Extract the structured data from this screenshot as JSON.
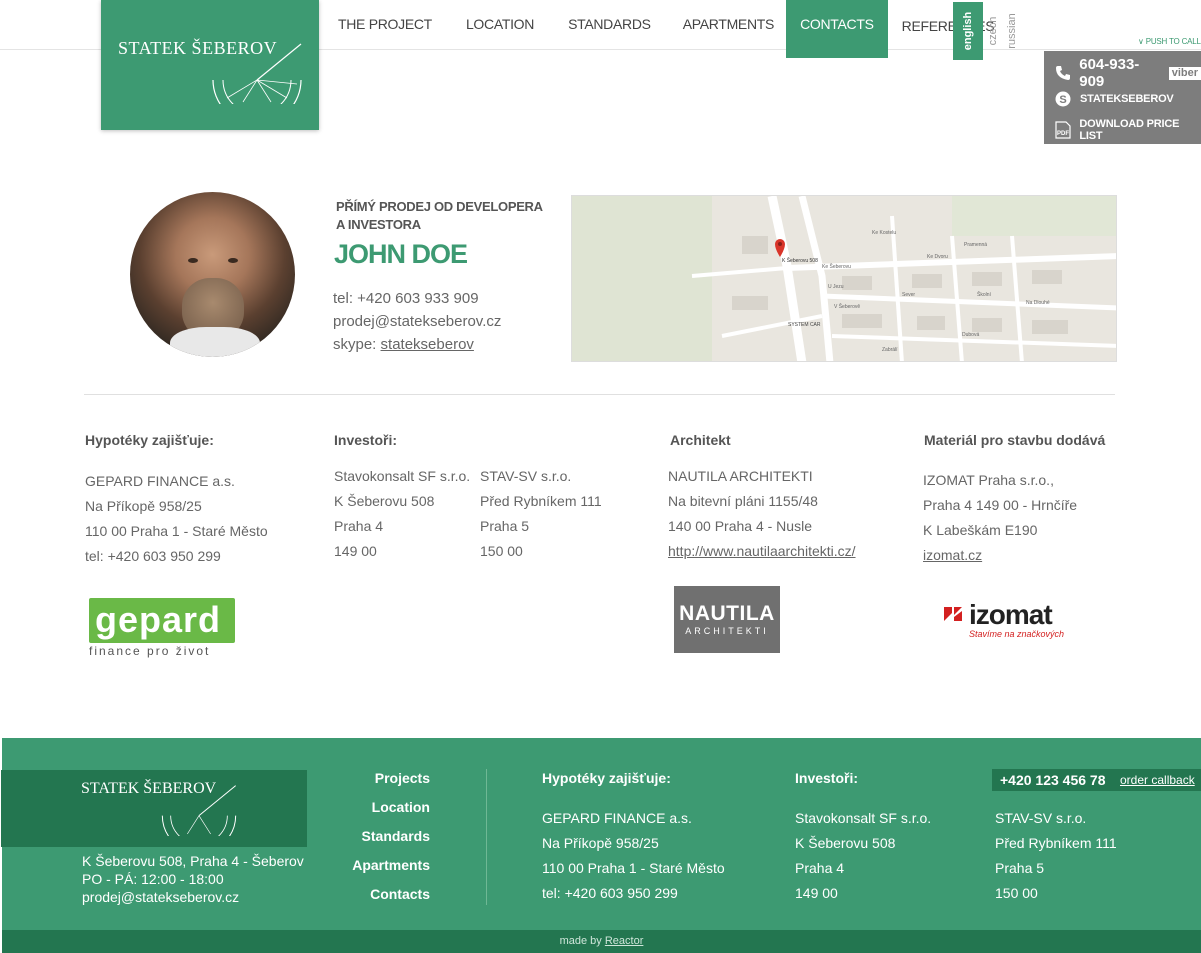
{
  "header": {
    "logo_text": "STATEK ŠEBEROV",
    "nav": [
      {
        "label": "THE PROJECT"
      },
      {
        "label": "LOCATION"
      },
      {
        "label": "STANDARDS"
      },
      {
        "label": "APARTMENTS"
      },
      {
        "label": "CONTACTS"
      },
      {
        "label": "REFERENCES"
      }
    ],
    "active_nav": "CONTACTS",
    "languages": [
      "english",
      "czech",
      "russian"
    ],
    "active_language": "english",
    "push_to_call": "PUSH TO CALL"
  },
  "callbox": {
    "phone": "604-933-909",
    "viber": "viber",
    "skype": "STATEKSEBEROV",
    "download": "DOWNLOAD PRICE LIST",
    "icons": [
      "phone-icon",
      "skype-icon",
      "pdf-icon"
    ]
  },
  "contact": {
    "subtitle_line1": "PŘÍMÝ PRODEJ OD DEVELOPERA",
    "subtitle_line2": "A INVESTORA",
    "name": "JOHN DOE",
    "tel": "tel: +420 603 933 909",
    "email": "prodej@statekseberov.cz",
    "skype_label": "skype: ",
    "skype_link": "statekseberov",
    "map_labels": [
      "K Šeberovu 508",
      "Pramenná",
      "Ke Kostelu",
      "Ke Šeberovu",
      "Ke Dvoru",
      "Školní",
      "Sever",
      "SYSTEM CAR",
      "V Šeberově",
      "U Jezu",
      "Zabrálí",
      "Dubová",
      "Na Dlouhé"
    ]
  },
  "partners": {
    "mortgage": {
      "heading": "Hypotéky zajišťuje:",
      "lines": [
        "GEPARD FINANCE a.s.",
        "Na Příkopě 958/25",
        "110 00 Praha 1 - Staré Město",
        "tel: +420 603 950 299"
      ],
      "logo_main": "gepard",
      "logo_sub": "finance pro život"
    },
    "investors": {
      "heading": "Investoři:",
      "col1": [
        "Stavokonsalt SF s.r.o.",
        "K Šeberovu 508",
        "Praha 4",
        "149 00"
      ],
      "col2": [
        "STAV-SV s.r.o.",
        "Před Rybníkem 111",
        "Praha 5",
        "150 00"
      ]
    },
    "architect": {
      "heading": "Architekt",
      "lines": [
        "NAUTILA ARCHITEKTI",
        "Na bitevní pláni 1155/48",
        "140 00 Praha 4 - Nusle"
      ],
      "link": "http://www.nautilaarchitekti.cz/",
      "logo_main": "NAUTILA",
      "logo_sub": "ARCHITEKTI"
    },
    "material": {
      "heading": "Materiál pro stavbu dodává",
      "lines": [
        "IZOMAT Praha s.r.o.,",
        "Praha 4 149 00 - Hrnčíře",
        "K Labeškám E190"
      ],
      "link": "izomat.cz",
      "logo_main": "izomat",
      "logo_sub": "Stavíme na značkových"
    }
  },
  "footer": {
    "logo_text": "STATEK ŠEBEROV",
    "address": "K Šeberovu 508, Praha 4 - Šeberov",
    "hours": "PO - PÁ: 12:00 - 18:00",
    "email": "prodej@statekseberov.cz",
    "nav": [
      "Projects",
      "Location",
      "Standards",
      "Apartments",
      "Contacts"
    ],
    "mortgage_heading": "Hypotéky zajišťuje:",
    "mortgage_lines": [
      "GEPARD FINANCE a.s.",
      "Na Příkopě 958/25",
      "110 00 Praha 1 - Staré Město",
      "tel: +420 603 950 299"
    ],
    "investors_heading": "Investoři:",
    "investors_col1": [
      "Stavokonsalt SF s.r.o.",
      "K Šeberovu 508",
      "Praha 4",
      "149 00"
    ],
    "investors_col2": [
      "STAV-SV s.r.o.",
      "Před Rybníkem 111",
      "Praha 5",
      "150 00"
    ],
    "phone": "+420 123 456 78",
    "order_callback": "order callback",
    "made_by_label": "made by ",
    "made_by_link": "Reactor"
  },
  "colors": {
    "brand_green": "#3d9a72",
    "dark_green": "#237650",
    "callbox_grey": "#7d7d7d"
  }
}
